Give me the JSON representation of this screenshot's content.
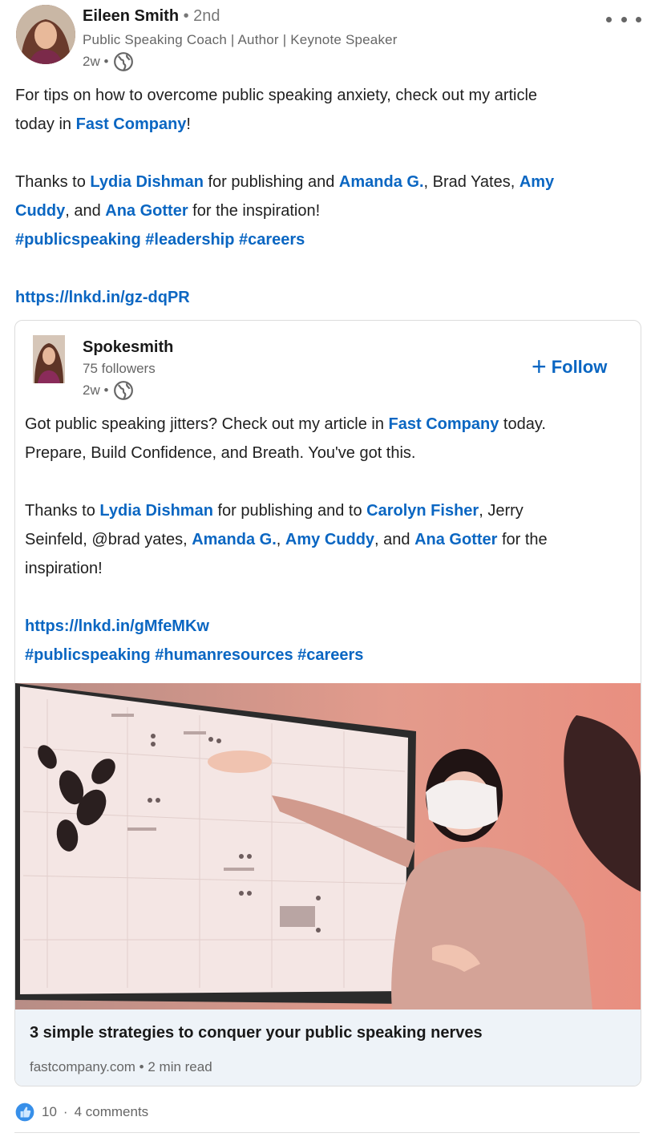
{
  "author": {
    "name": "Eileen Smith",
    "degree": "• 2nd",
    "headline": "Public Speaking Coach | Author | Keynote Speaker",
    "time": "2w •"
  },
  "post": {
    "line1a": "For tips on how to overcome public speaking anxiety, check out my article",
    "line1b": "today in ",
    "fast_company": "Fast Company",
    "bang": "!",
    "thanks_to": "Thanks to ",
    "lydia": "Lydia Dishman",
    "for_publishing": " for publishing and ",
    "amanda": "Amanda G.",
    "brad": ", Brad Yates, ",
    "amy1": "Amy",
    "amy2": "Cuddy",
    "and": ", and ",
    "ana": "Ana Gotter",
    "inspiration": " for the inspiration!",
    "hashtags": "#publicspeaking #leadership #careers",
    "url": "https://lnkd.in/gz-dqPR"
  },
  "shared": {
    "name": "Spokesmith",
    "followers": "75 followers",
    "time": "2w •",
    "follow_plus": "+",
    "follow_label": "Follow",
    "l1a": "Got public speaking jitters? Check out my article in ",
    "fast_company": "Fast Company",
    "l1b": " today.",
    "l2": "Prepare, Build Confidence, and Breath. You've got this.",
    "thanks_to": "Thanks to ",
    "lydia": "Lydia Dishman",
    "for_pub": " for publishing and to ",
    "carolyn": "Carolyn Fisher",
    "jerry": ", Jerry",
    "seinfeld": "Seinfeld, @brad yates, ",
    "amanda": "Amanda G.",
    "comma": ", ",
    "amy": "Amy Cuddy",
    "and": ", and ",
    "ana": "Ana Gotter",
    "forthe": " for the",
    "inspiration": "inspiration!",
    "url": "https://lnkd.in/gMfeMKw",
    "hashtags": "#publicspeaking #humanresources #careers",
    "article_title": "3 simple strategies to conquer your public speaking nerves",
    "article_source": "fastcompany.com • 2 min read"
  },
  "social": {
    "reactions": "10",
    "sep": "·",
    "comments": "4 comments"
  },
  "colors": {
    "link": "#0a66c2",
    "muted": "#666666",
    "footer_bg": "#eef3f8"
  },
  "icons": [
    "globe-icon",
    "more-icon",
    "plus-icon",
    "like-icon"
  ]
}
